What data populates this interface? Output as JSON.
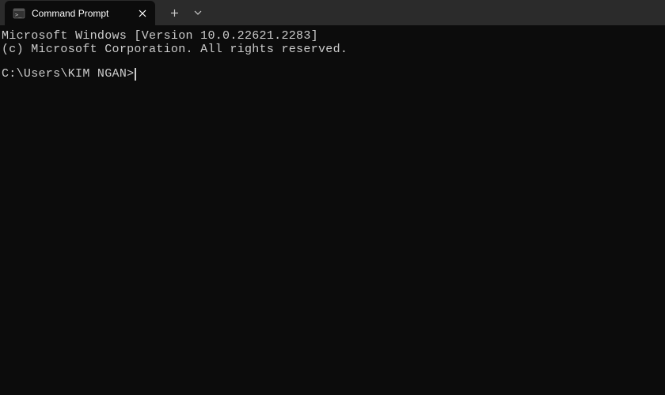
{
  "tab": {
    "title": "Command Prompt"
  },
  "terminal": {
    "line1": "Microsoft Windows [Version 10.0.22621.2283]",
    "line2": "(c) Microsoft Corporation. All rights reserved.",
    "prompt": "C:\\Users\\KIM NGAN>"
  }
}
